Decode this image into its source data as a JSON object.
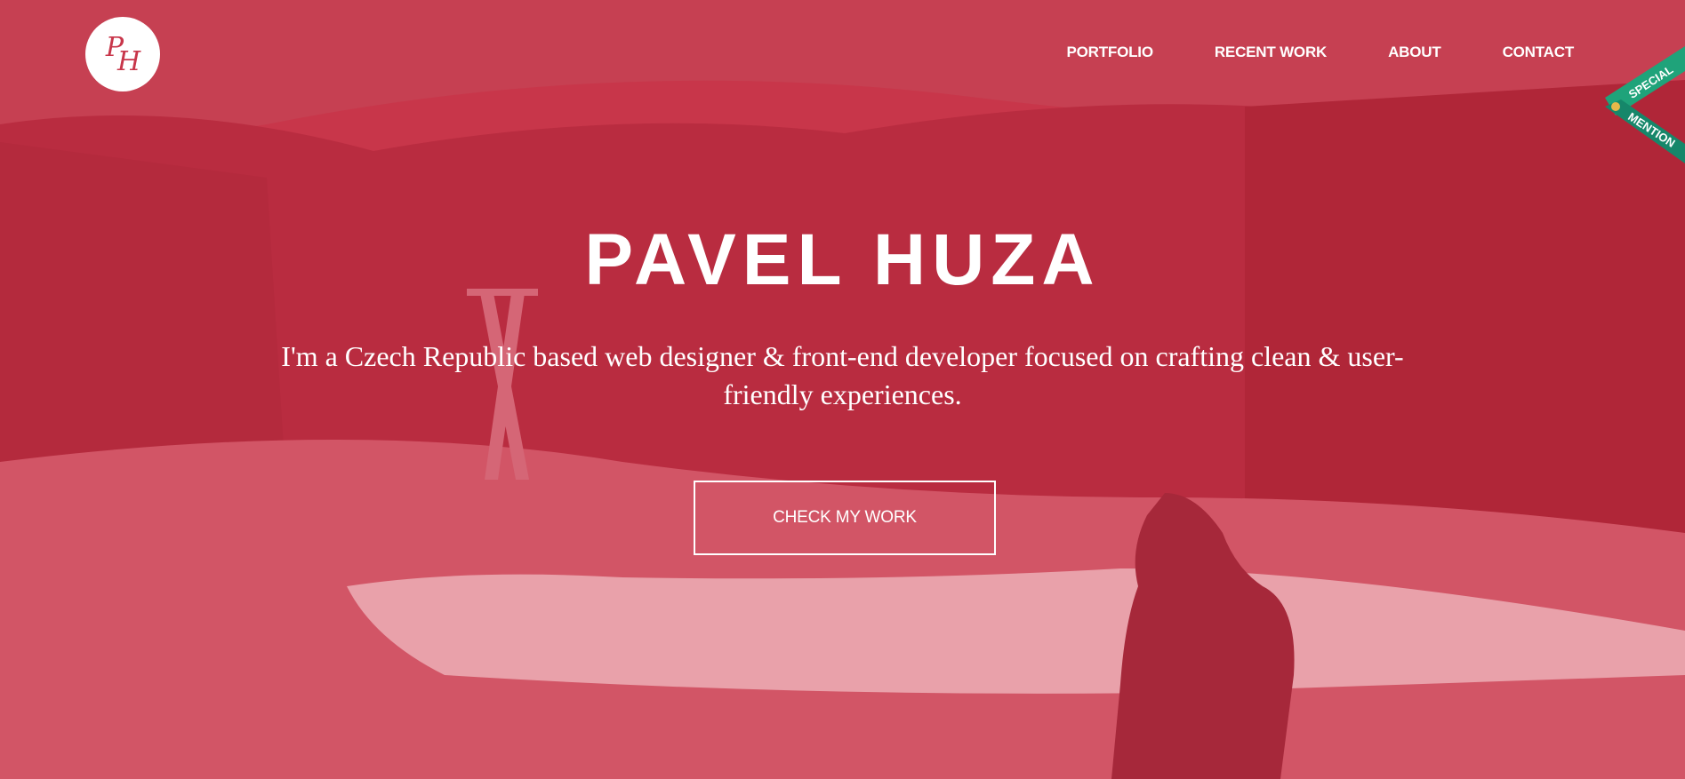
{
  "logo": {
    "monogram_top": "P",
    "monogram_bottom": "H"
  },
  "nav": {
    "items": [
      {
        "label": "PORTFOLIO"
      },
      {
        "label": "RECENT WORK"
      },
      {
        "label": "ABOUT"
      },
      {
        "label": "CONTACT"
      }
    ]
  },
  "hero": {
    "title": "PAVEL HUZA",
    "intro": "I'm a Czech Republic based web designer & front-end developer focused on crafting clean & user-friendly experiences.",
    "cta_label": "CHECK MY WORK"
  },
  "ribbon": {
    "line1": "SPECIAL",
    "line2": "MENTION"
  },
  "colors": {
    "overlay": "#c8364a",
    "ribbon": "#1fa37a",
    "text": "#ffffff"
  }
}
